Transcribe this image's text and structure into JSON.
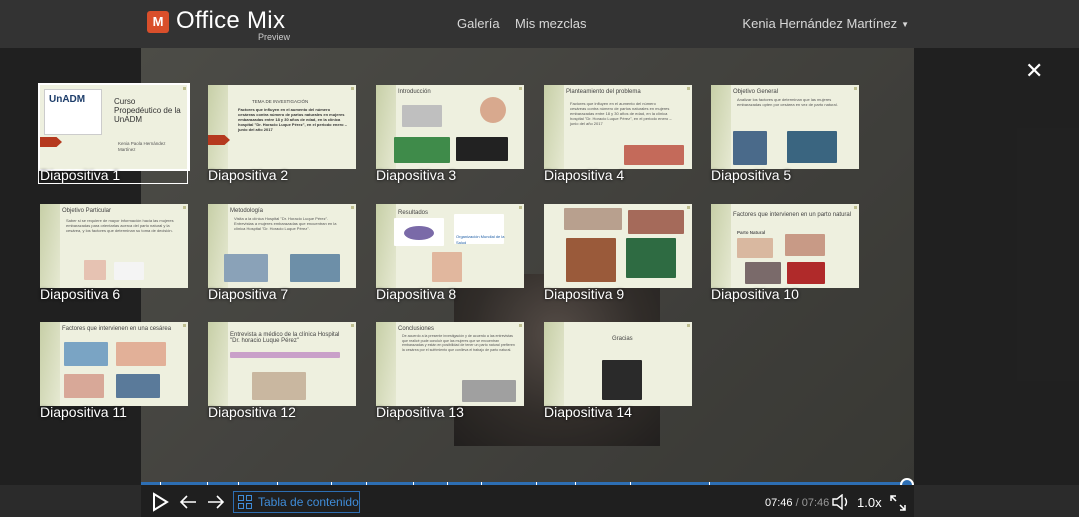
{
  "app": {
    "logo_letter": "M",
    "name": "Office Mix",
    "badge": "Preview"
  },
  "nav": {
    "gallery": "Galería",
    "my_mixes": "Mis mezclas",
    "user_name": "Kenia Hernández Martínez"
  },
  "overlay": {
    "close_icon": "close-icon"
  },
  "slides": [
    {
      "label": "Diapositiva 1",
      "title": "Curso Propedéutico de la UnADM",
      "subtitle": "Kenia Paola Hernández Martínez",
      "logo": "UnADM",
      "selected": true
    },
    {
      "label": "Diapositiva 2",
      "title": "TEMA DE INVESTIGACIÓN",
      "body": "Factores que influyen en el aumento del número cesáreas contra número de partos naturales en mujeres embarazadas entre 18 y 30 años de edad, en la clínica hospital \"Dr. Horacio Luque Pérez\", en el periodo enero – junio del año 2017"
    },
    {
      "label": "Diapositiva 3",
      "title": "Introducción",
      "body": "Parto normal / Cesárea"
    },
    {
      "label": "Diapositiva 4",
      "title": "Planteamiento del problema",
      "body": "Factores que influyen en el aumento del número cesáreas contra número de partos naturales en mujeres embarazadas entre 18 y 30 años de edad, en la clínica hospital \"Dr. Horacio Luque Pérez\", en el periodo enero – junio del año 2017",
      "tag": "Parto Vs Cesárea"
    },
    {
      "label": "Diapositiva 5",
      "title": "Objetivo General",
      "body": "Analizar los factores que determinan que las mujeres embarazadas opten por cesárea en vez de parto natural."
    },
    {
      "label": "Diapositiva 6",
      "title": "Objetivo Particular",
      "body": "Saber si se requiere de mayor información hacia las mujeres embarazadas para orientarlas acerca del parto natural y la cesárea, y los factores que determinan su toma de decisión.",
      "tag": "PARTO NATURAL VS CESÁREA"
    },
    {
      "label": "Diapositiva 7",
      "title": "Metodología",
      "body": "Visita a la clínica Hospital \"Dr. Horacio Luque Pérez\". Entrevistas a mujeres embarazadas que encuentran en la clínica Hospital \"Dr. Horacio Luque Pérez\"."
    },
    {
      "label": "Diapositiva 8",
      "title": "Resultados",
      "body": "Organización Mundial de la Salud"
    },
    {
      "label": "Diapositiva 9",
      "title": "",
      "body": ""
    },
    {
      "label": "Diapositiva 10",
      "title": "Factores que intervienen en un parto natural",
      "body": "Parto Natural"
    },
    {
      "label": "Diapositiva 11",
      "title": "Factores que intervienen en una cesárea",
      "body": ""
    },
    {
      "label": "Diapositiva 12",
      "title": "Entrevista a médico de la clínica Hospital \"Dr. horacio Luque Pérez\"",
      "body": ""
    },
    {
      "label": "Diapositiva 13",
      "title": "Conclusiones",
      "body": "De acuerdo a la presente investigación y de acuerdo a las entrevistas que realicé pude concluir que las mujeres que se encuentran embarazadas y están en posibilidad de tener un parto natural prefieren la cesárea por el sufrimiento que conlleva el trabajo de parto natural."
    },
    {
      "label": "Diapositiva 14",
      "title": "Gracias",
      "body": ""
    }
  ],
  "player": {
    "progress": 1.0,
    "toc_label": "Tabla de contenido",
    "time_current": "07:46",
    "time_sep": "/",
    "time_total": "07:46",
    "speed": "1.0x",
    "play_icon": "play-icon",
    "prev_icon": "arrow-left-icon",
    "next_icon": "arrow-right-icon",
    "volume_icon": "volume-icon",
    "fullscreen_icon": "fullscreen-icon"
  },
  "colors": {
    "accent": "#2d6eb3",
    "logo_red": "#d94f2b",
    "slide_bg": "#eef0df"
  }
}
